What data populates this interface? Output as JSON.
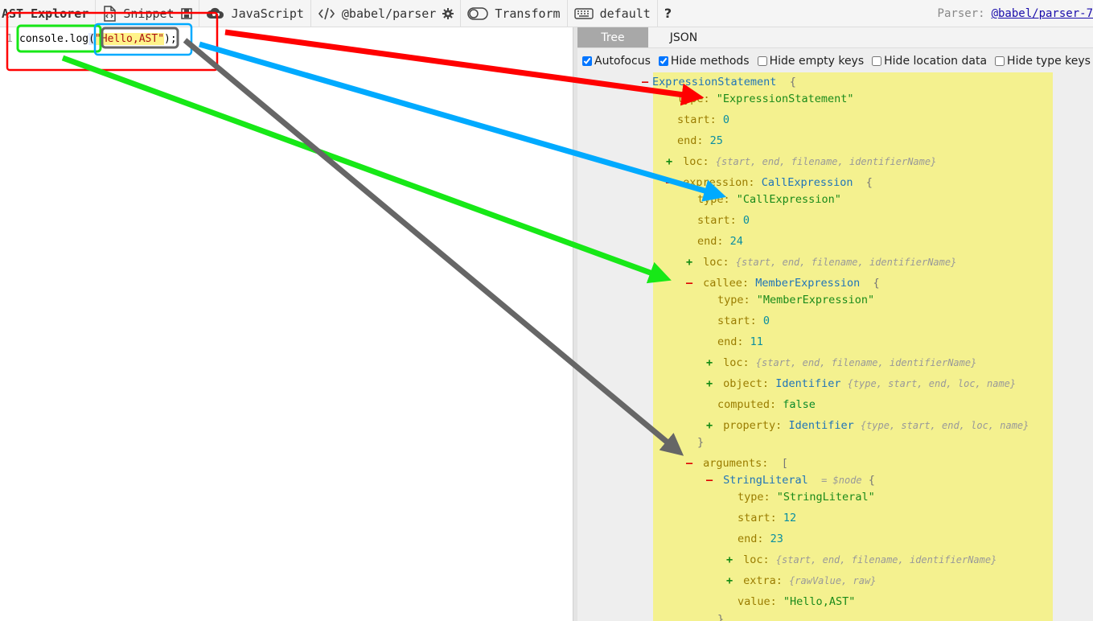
{
  "toolbar": {
    "title": "AST Explorer",
    "snippet": "Snippet",
    "language": "JavaScript",
    "parser": "@babel/parser",
    "transform": "Transform",
    "keymap": "default",
    "help": "?",
    "parser_label": "Parser:",
    "parser_link": "@babel/parser-7"
  },
  "editor": {
    "line_number": "1",
    "code": {
      "part1": "console.log",
      "open_paren": "(",
      "string": "\"Hello,AST\"",
      "close": ");"
    }
  },
  "tabs": {
    "tree": "Tree",
    "json": "JSON"
  },
  "options": {
    "autofocus": "Autofocus",
    "hide_methods": "Hide methods",
    "hide_empty_keys": "Hide empty keys",
    "hide_location_data": "Hide location data",
    "hide_type_keys": "Hide type keys"
  },
  "tree": {
    "root": {
      "type": "ExpressionStatement",
      "open": "{"
    },
    "r_type": {
      "key": "type:",
      "value": "\"ExpressionStatement\""
    },
    "r_start": {
      "key": "start:",
      "value": "0"
    },
    "r_end": {
      "key": "end:",
      "value": "25"
    },
    "r_loc": {
      "key": "loc:",
      "summary": "{start, end, filename, identifierName}"
    },
    "expr": {
      "key": "expression:",
      "type": "CallExpression",
      "open": "{"
    },
    "e_type": {
      "key": "type:",
      "value": "\"CallExpression\""
    },
    "e_start": {
      "key": "start:",
      "value": "0"
    },
    "e_end": {
      "key": "end:",
      "value": "24"
    },
    "e_loc": {
      "key": "loc:",
      "summary": "{start, end, filename, identifierName}"
    },
    "callee": {
      "key": "callee:",
      "type": "MemberExpression",
      "open": "{"
    },
    "c_type": {
      "key": "type:",
      "value": "\"MemberExpression\""
    },
    "c_start": {
      "key": "start:",
      "value": "0"
    },
    "c_end": {
      "key": "end:",
      "value": "11"
    },
    "c_loc": {
      "key": "loc:",
      "summary": "{start, end, filename, identifierName}"
    },
    "c_object": {
      "key": "object:",
      "type": "Identifier",
      "summary": "{type, start, end, loc, name}"
    },
    "c_computed": {
      "key": "computed:",
      "value": "false"
    },
    "c_property": {
      "key": "property:",
      "type": "Identifier",
      "summary": "{type, start, end, loc, name}"
    },
    "c_close": "}",
    "args": {
      "key": "arguments:",
      "open": "["
    },
    "sl": {
      "type": "StringLiteral",
      "node": "= $node",
      "open": "{"
    },
    "s_type": {
      "key": "type:",
      "value": "\"StringLiteral\""
    },
    "s_start": {
      "key": "start:",
      "value": "12"
    },
    "s_end": {
      "key": "end:",
      "value": "23"
    },
    "s_loc": {
      "key": "loc:",
      "summary": "{start, end, filename, identifierName}"
    },
    "s_extra": {
      "key": "extra:",
      "summary": "{rawValue, raw}"
    },
    "s_value": {
      "key": "value:",
      "value": "\"Hello,AST\""
    },
    "s_close": "}"
  },
  "colors": {
    "red": "#ff0000",
    "green": "#17e817",
    "blue": "#00aaff",
    "gray": "#666666",
    "tree_bg": "#f4f18f"
  }
}
